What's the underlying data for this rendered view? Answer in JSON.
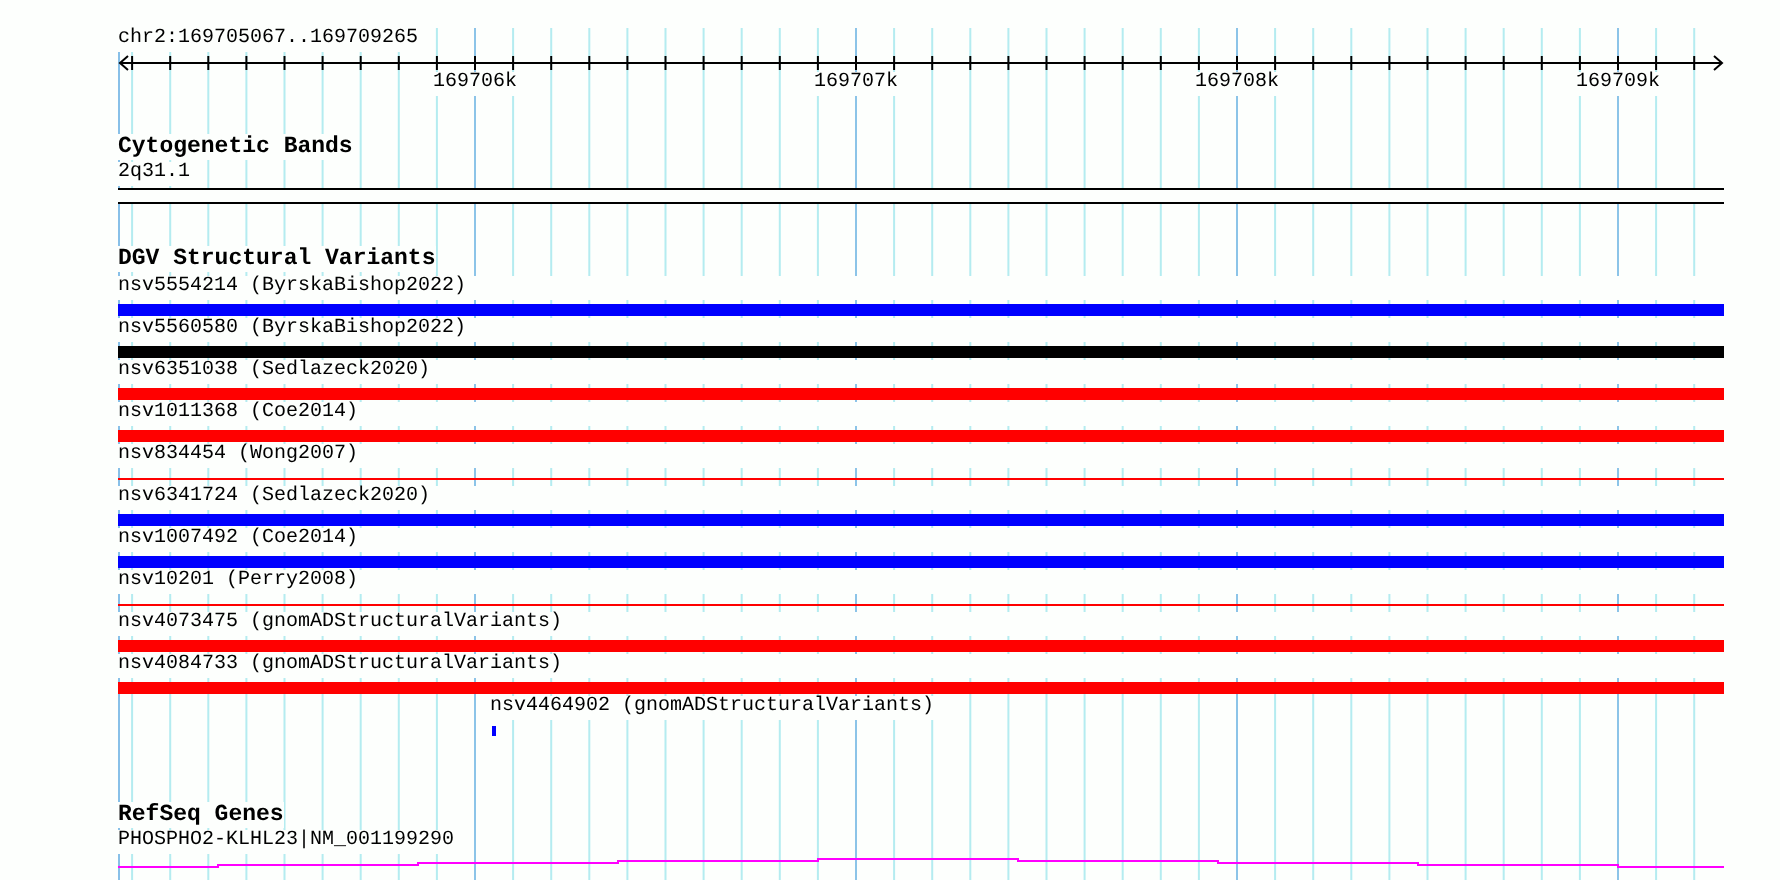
{
  "ruler": {
    "region": "chr2:169705067..169709265",
    "ticks": [
      "169706k",
      "169707k",
      "169708k",
      "169709k"
    ]
  },
  "tracks": [
    {
      "title": "Cytogenetic Bands",
      "kind": "bands",
      "items": [
        {
          "label": "2q31.1"
        }
      ]
    },
    {
      "title": "DGV Structural Variants",
      "kind": "variants",
      "items": [
        {
          "label": "nsv5554214 (ByrskaBishop2022)",
          "kind": "thick",
          "color": "#0000ff"
        },
        {
          "label": "nsv5560580 (ByrskaBishop2022)",
          "kind": "thick",
          "color": "#000000"
        },
        {
          "label": "nsv6351038 (Sedlazeck2020)",
          "kind": "thick",
          "color": "#ff0000"
        },
        {
          "label": "nsv1011368 (Coe2014)",
          "kind": "thick",
          "color": "#ff0000"
        },
        {
          "label": "nsv834454 (Wong2007)",
          "kind": "thin",
          "color": "#ff0000"
        },
        {
          "label": "nsv6341724 (Sedlazeck2020)",
          "kind": "thick",
          "color": "#0000ff"
        },
        {
          "label": "nsv1007492 (Coe2014)",
          "kind": "thick",
          "color": "#0000ff"
        },
        {
          "label": "nsv10201 (Perry2008)",
          "kind": "thin",
          "color": "#ff0000"
        },
        {
          "label": "nsv4073475 (gnomADStructuralVariants)",
          "kind": "thick",
          "color": "#ff0000"
        },
        {
          "label": "nsv4084733 (gnomADStructuralVariants)",
          "kind": "thick",
          "color": "#ff0000"
        },
        {
          "label": "nsv4464902 (gnomADStructuralVariants)",
          "kind": "point",
          "color": "#0000ff"
        }
      ]
    },
    {
      "title": "RefSeq Genes",
      "kind": "genes",
      "items": [
        {
          "label": "PHOSPHO2-KLHL23|NM_001199290",
          "color": "#ff00ff"
        }
      ]
    }
  ]
}
